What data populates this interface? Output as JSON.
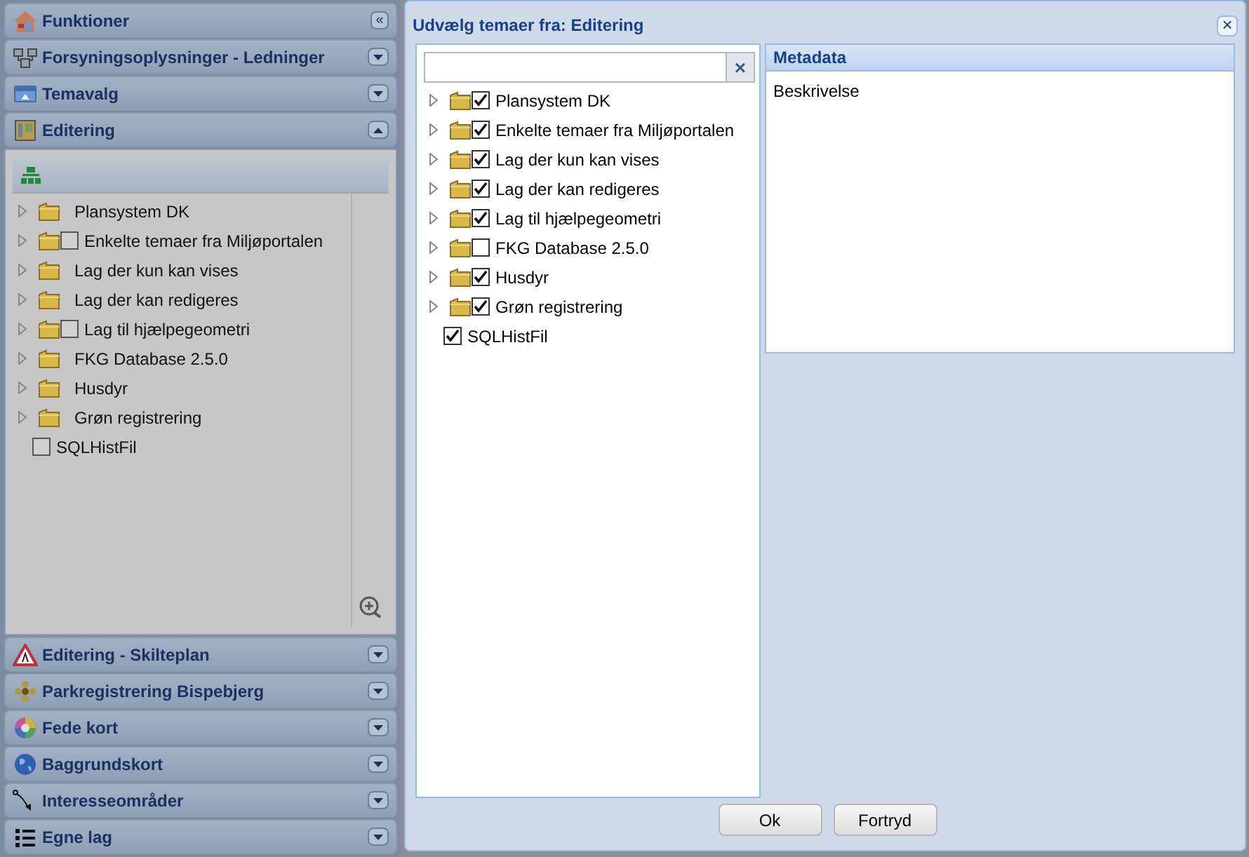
{
  "sidebar": {
    "collapse_button": "«",
    "sections": [
      {
        "title": "Funktioner",
        "kind": "top"
      },
      {
        "title": "Forsyningsoplysninger - Ledninger",
        "expanded": false,
        "kind": "section"
      },
      {
        "title": "Temavalg",
        "expanded": false,
        "kind": "section"
      },
      {
        "title": "Editering",
        "expanded": true,
        "kind": "section",
        "tree": [
          {
            "label": "Plansystem DK",
            "kind": "folder"
          },
          {
            "label": "Enkelte temaer fra Miljøportalen",
            "kind": "folder-checkbox",
            "checked": false
          },
          {
            "label": "Lag der kun kan vises",
            "kind": "folder"
          },
          {
            "label": "Lag der kan redigeres",
            "kind": "folder"
          },
          {
            "label": "Lag til hjælpegeometri",
            "kind": "folder-checkbox",
            "checked": false
          },
          {
            "label": "FKG Database 2.5.0",
            "kind": "folder"
          },
          {
            "label": "Husdyr",
            "kind": "folder"
          },
          {
            "label": "Grøn registrering",
            "kind": "folder"
          },
          {
            "label": "SQLHistFil",
            "kind": "checkbox",
            "checked": false
          }
        ]
      },
      {
        "title": "Editering - Skilteplan",
        "expanded": false,
        "kind": "section"
      },
      {
        "title": "Parkregistrering Bispebjerg",
        "expanded": false,
        "kind": "section"
      },
      {
        "title": "Fede kort",
        "expanded": false,
        "kind": "section"
      },
      {
        "title": "Baggrundskort",
        "expanded": false,
        "kind": "section"
      },
      {
        "title": "Interesseområder",
        "expanded": false,
        "kind": "section"
      },
      {
        "title": "Egne lag",
        "expanded": false,
        "kind": "section"
      }
    ]
  },
  "dialog": {
    "title": "Udvælg temaer fra: Editering",
    "search": {
      "clear": "×"
    },
    "tree": [
      {
        "label": "Plansystem DK",
        "kind": "folder-checkbox",
        "checked": true
      },
      {
        "label": "Enkelte temaer fra Miljøportalen",
        "kind": "folder-checkbox",
        "checked": true
      },
      {
        "label": "Lag der kun kan vises",
        "kind": "folder-checkbox",
        "checked": true
      },
      {
        "label": "Lag der kan redigeres",
        "kind": "folder-checkbox",
        "checked": true
      },
      {
        "label": "Lag til hjælpegeometri",
        "kind": "folder-checkbox",
        "checked": true
      },
      {
        "label": "FKG Database 2.5.0",
        "kind": "folder-checkbox",
        "checked": false
      },
      {
        "label": "Husdyr",
        "kind": "folder-checkbox",
        "checked": true
      },
      {
        "label": "Grøn registrering",
        "kind": "folder-checkbox",
        "checked": true
      },
      {
        "label": "SQLHistFil",
        "kind": "checkbox",
        "checked": true
      }
    ],
    "close_button": "×",
    "metadata": {
      "title": "Metadata",
      "text": "Beskrivelse"
    },
    "buttons": [
      "Ok",
      "Fortryd"
    ]
  }
}
